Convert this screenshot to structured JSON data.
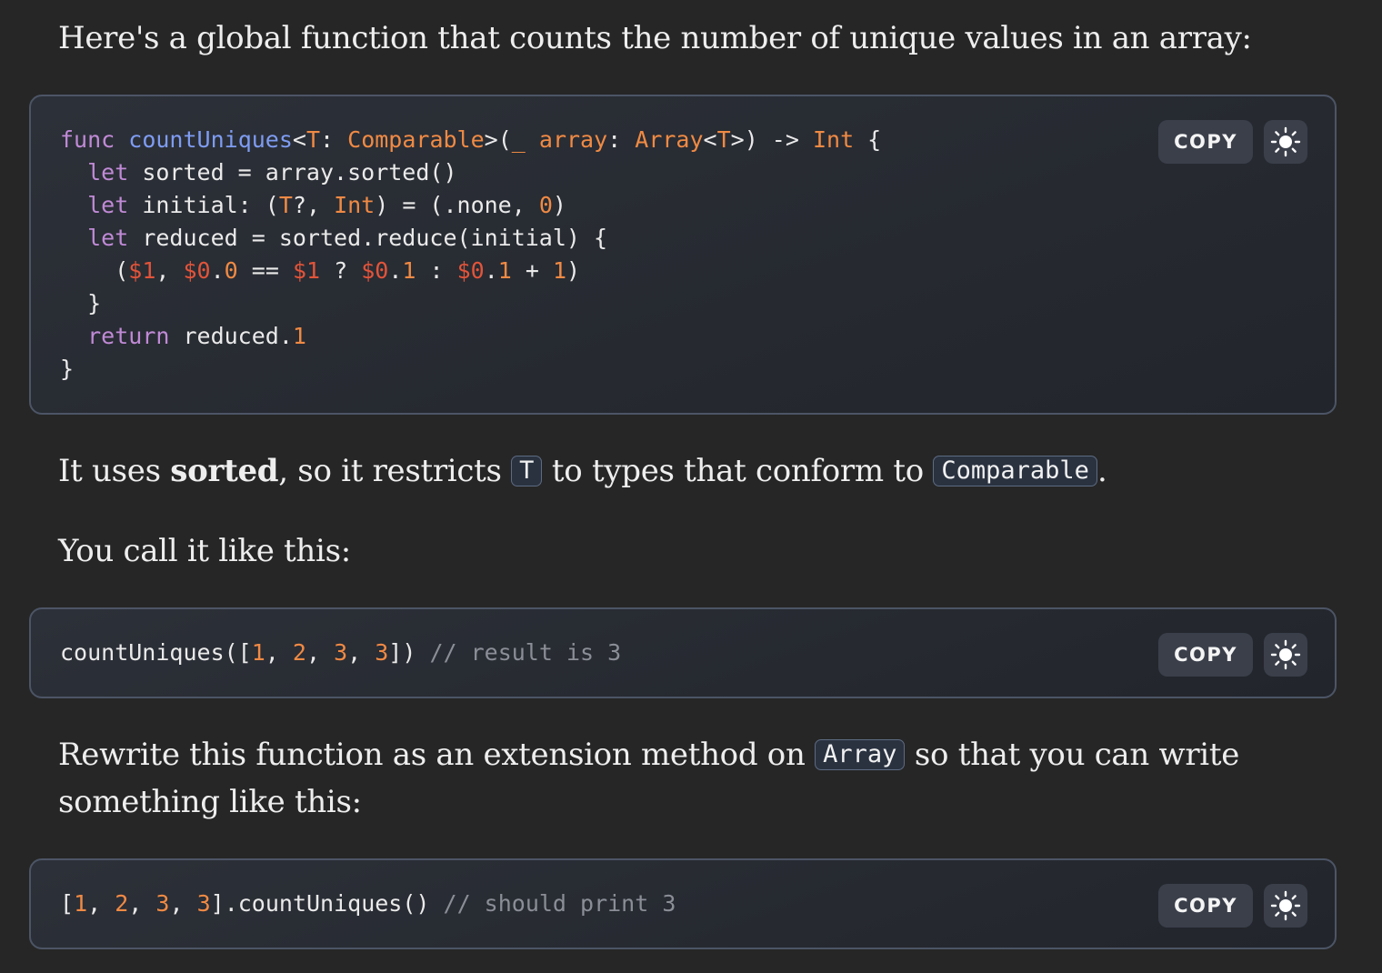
{
  "paragraphs": {
    "intro": "Here's a global function that counts the number of unique values in an array:",
    "uses_prefix": "It uses ",
    "uses_bold": "sorted",
    "uses_middle": ", so it restricts ",
    "uses_code_t": "T",
    "uses_middle2": " to types that conform to ",
    "uses_code_comparable": "Comparable",
    "uses_suffix": ".",
    "call": "You call it like this:",
    "rewrite_prefix": "Rewrite this function as an extension method on ",
    "rewrite_code": "Array",
    "rewrite_suffix_line1": " so that you can write",
    "rewrite_line2": "something like this:"
  },
  "code_blocks": [
    {
      "language": "swift",
      "lines": [
        "func countUniques<T: Comparable>(_ array: Array<T>) -> Int {",
        "  let sorted = array.sorted()",
        "  let initial: (T?, Int) = (.none, 0)",
        "  let reduced = sorted.reduce(initial) {",
        "    ($1, $0.0 == $1 ? $0.1 : $0.1 + 1)",
        "  }",
        "  return reduced.1",
        "}"
      ],
      "copy_label": "COPY"
    },
    {
      "language": "swift",
      "lines": [
        "countUniques([1, 2, 3, 3]) // result is 3"
      ],
      "copy_label": "COPY"
    },
    {
      "language": "swift",
      "lines": [
        "[1, 2, 3, 3].countUniques() // should print 3"
      ],
      "copy_label": "COPY"
    }
  ],
  "icons": {
    "theme_toggle": "sun-icon"
  },
  "colors": {
    "background": "#262626",
    "keyword": "#c08ad6",
    "function": "#7e9cf2",
    "type": "#f08a44",
    "number": "#f08a44",
    "dollar": "#e2543a",
    "comment": "#8b8e96"
  }
}
